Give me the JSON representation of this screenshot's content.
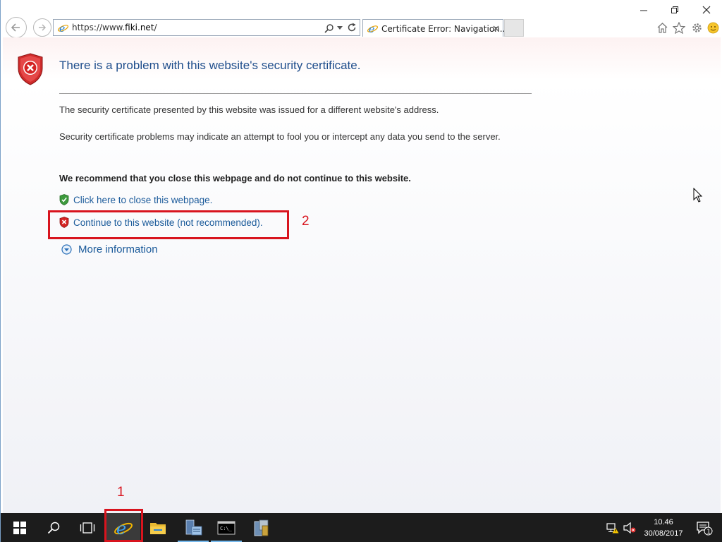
{
  "browser": {
    "url_prefix": "https://www.",
    "url_domain": "fiki.net",
    "url_suffix": "/",
    "tab_title": "Certificate Error: Navigation..."
  },
  "content": {
    "headline": "There is a problem with this website's security certificate.",
    "para1": "The security certificate presented by this website was issued for a different website's address.",
    "para2": "Security certificate problems may indicate an attempt to fool you or intercept any data you send to the server.",
    "recommend": "We recommend that you close this webpage and do not continue to this website.",
    "close_link": "Click here to close this webpage.",
    "continue_link": "Continue to this website (not recommended).",
    "more_info": "More information"
  },
  "annotations": {
    "label_1": "1",
    "label_2": "2",
    "color": "#d8141e"
  },
  "taskbar": {
    "time": "10.46",
    "date": "30/08/2017",
    "notification_count": "1",
    "icons": [
      "windows-start-icon",
      "search-icon",
      "task-view-icon",
      "internet-explorer-icon",
      "file-explorer-icon",
      "server-manager-icon",
      "command-prompt-icon",
      "tools-icon"
    ]
  },
  "colors": {
    "link": "#1a5a9a",
    "headline": "#1f4e8c",
    "taskbar": "#1c1c1c"
  }
}
